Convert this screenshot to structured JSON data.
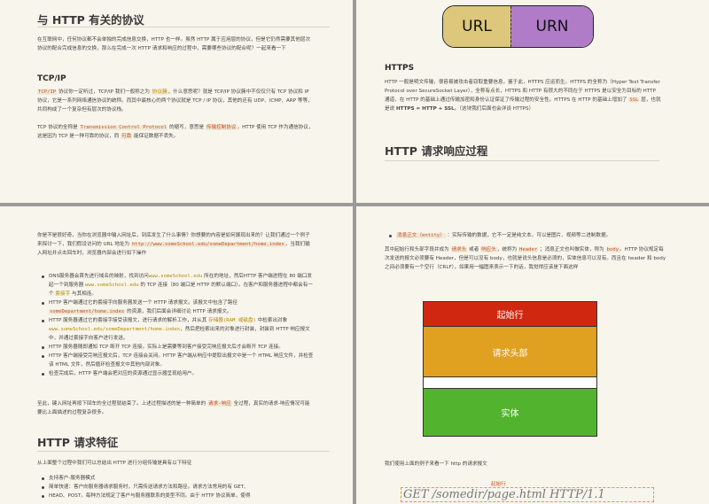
{
  "p1": {
    "title": "与 HTTP 有关的协议",
    "intro": "在互联网中，任何协议都不会单独的完成信息交换，HTTP 也一样。虽然 HTTP 属于应用层的协议，但是它仍然需要其他层次协议的配合完成信息的交换，那么在完成一次 HTTP 请求和响应的过程中，需要哪些协议的配合呢？一起来看一下",
    "tcp_heading": "TCP/IP",
    "tcp_code": "TCP/IP",
    "tcp_p1a": "协议你一定听过，TCP/IP 我们一般称之为",
    "tcp_code2": "协议簇",
    "tcp_p1b": "，什么意思呢？就是 TCP/IP 协议簇中不仅仅只有 TCP 协议和 IP 协议，它是一系列网络通信协议的统称。而其中最核心的两个协议就是 TCP / IP 协议，其他的还有 UDP、ICMP、ARP 等等，共同构成了一个复杂但有层次的协议栈。",
    "tcp_p2a": "TCP 协议的全称是",
    "tcp_code3": "Transmission Control Protocol",
    "tcp_p2b": "的缩写，意思是",
    "tcp_code4": "传输控制协议",
    "tcp_p2c": "，HTTP 使用 TCP 作为通信协议，这是因为 TCP 是一种可靠的协议，而",
    "tcp_code5": "可靠",
    "tcp_p2d": "能保证数据不丢失。"
  },
  "p2": {
    "url": "URL",
    "urn": "URN",
    "https_heading": "HTTPS",
    "https_p1": "HTTP 一般是明文传输，很容易被攻击者窃取重要信息，鉴于此，HTTPS 应运而生。HTTPS 的全称为（Hyper Text Transfer Protocol over SecureSocket Layer），全称有点长，HTTPS 和 HTTP 有很大的不同在于 HTTPS 是以安全为目标的 HTTP 通道，在 HTTP 的基础上通过传输加密和身份认证保证了传输过程的安全性。HTTPS 在 HTTP 的基础上增加了",
    "https_code": "SSL",
    "https_p1b": "层，也就是说",
    "https_bold": "HTTPS = HTTP + SSL",
    "https_p1c": "。（这块我们后面也会详谈 HTTPS）",
    "title": "HTTP 请求响应过程"
  },
  "p3": {
    "p1a": "你是不是很好奇，当你在浏览器中输入网址后，到底发生了什么事情？你想要的内容是如何展现出来的？让我们通过一个例子来探讨一下，我们假设访问的 URL 地址为",
    "url_code": "http://www.someSchool.edu/someDepartment/home.index",
    "p1b": "，当我们输入网址并点击回车时，浏览器内部会进行如下操作",
    "bullets": [
      {
        "a": "DNS服务器会首先进行域名的映射，找到访问",
        "code": "www.someSchool.edu",
        "b": "所在的地址，然后HTTP 客户端进程在 80 端口发起一个到服务器",
        "code2": "www.someSchool.edu",
        "c": "的 TCP 连接（80 端口是 HTTP 的默认端口）。在客户和服务器进程中都会有一个",
        "code3": "套接字",
        "d": "与其相连。"
      },
      {
        "a": "HTTP 客户端通过它的套接字向服务器发送一个 HTTP 请求报文。该报文中包含了路径",
        "code": "someDepartment/home.index",
        "b": "的资源，我们后面会详细讨论 HTTP 请求报文。"
      },
      {
        "a": "HTTP 服务器通过它的套接字接受该报文，进行请求的解析工作，并从其",
        "code": "存储器(RAM 或磁盘)",
        "b": "中检索出对象",
        "code2": "www.someSchool.edu/someDepartment/home.index",
        "c": "，然后把检索出来的对象进行封装，封装到 HTTP 响应报文中，并通过套接字向客户进行发送。"
      },
      {
        "a": "HTTP 服务器随即通知 TCP 断开 TCP 连接，实际上是需要等到客户接受完响应报文后才会断开 TCP 连接。"
      },
      {
        "a": "HTTP 客户端接受完响应报文后，TCP 连接会关闭。HTTP 客户端从响应中提取出报文中是一个 HTML 响应文件，并检查该 HTML 文件，然后循环检查报文中其他内部对象。"
      },
      {
        "a": "检查完成后，HTTP 客户端会把对应的资源通过显示器呈现给用户。"
      }
    ],
    "p2a": "至此，键入网址再按下回车的全过程就结束了。上述过程描述的是一种简单的",
    "p2code": "请求-响应",
    "p2b": "全过程，真实的请求-响应情况可能要比上面描述的过程复杂很多。",
    "title": "HTTP 请求特征",
    "p3": "从上面整个过程中我们可以总结出 HTTP 进行分组传输是具有以下特征",
    "features": [
      "支持客户-服务器模式",
      "简单快速：客户向服务器请求服务时，只需传送请求方法和路径。请求方法常用的有 GET、",
      "HEAD、POST。每种方法规定了客户与服务器联系的类型不同。由于 HTTP 协议简单，使得"
    ]
  },
  "p4": {
    "b1code": "消息正文（entity）",
    "b1": "：实际传输的数据，它不一定是纯文本，可以是图片、视频等二进制数据。",
    "p1a": "其中起始行和头部字段并成为",
    "p1code": "请求头",
    "p1b": "或者",
    "p1code2": "响应头",
    "p1c": "，统称为",
    "p1code3": "Header",
    "p1d": "；消息正文也叫做实体，称为",
    "p1code4": "body",
    "p1e": "。HTTP 协议规定每次发送的报文必须要有 Header，但是可以没有 body，也就是说头信息是必须的，实体信息可以没有。而且在 header 和 body 之间必须要有一个空行（CRLF），如果用一幅图来表示一下的话，我觉得应该是下面这样",
    "box_start": "起始行",
    "box_header": "请求头部",
    "box_body": "实体",
    "p2": "我们使用上面的例子来看一下 http 的请求报文",
    "anno": "起始行",
    "req": "GET /somedir/page.html HTTP/1.1"
  },
  "colors": {
    "box_start": "#d02810",
    "box_header": "#e0a020",
    "box_body": "#52b42e",
    "url_bg": "#dcc77a",
    "urn_bg": "#b07cc8"
  }
}
